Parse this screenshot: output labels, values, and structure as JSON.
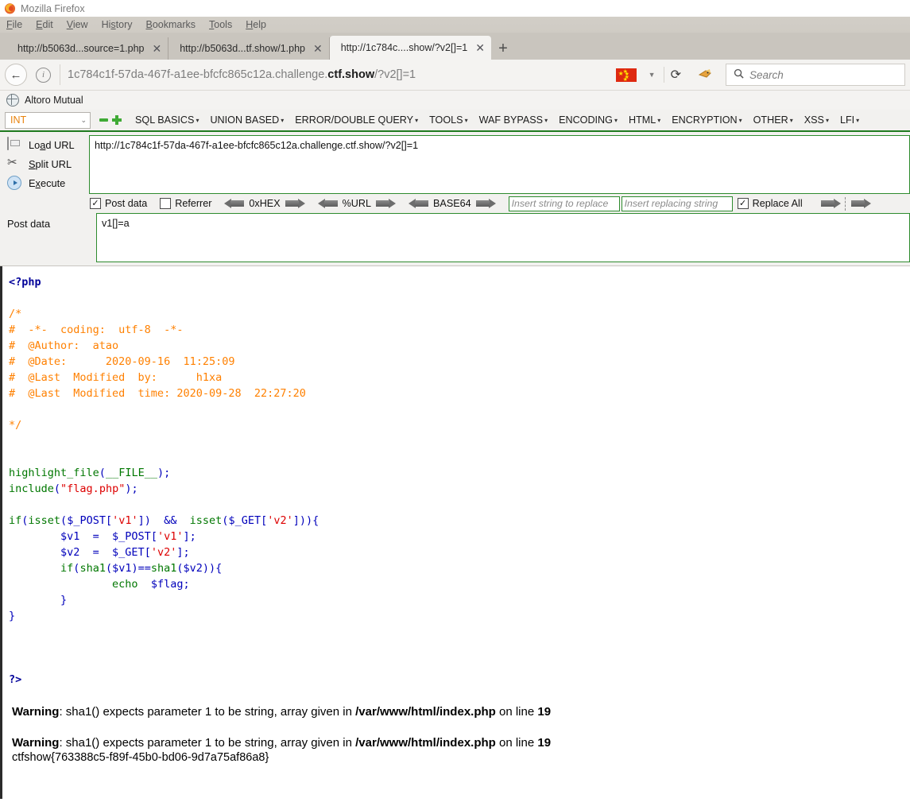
{
  "window": {
    "title": "Mozilla Firefox",
    "logo_icon": "firefox-logo"
  },
  "menubar": {
    "items": [
      "File",
      "Edit",
      "View",
      "History",
      "Bookmarks",
      "Tools",
      "Help"
    ]
  },
  "tabs": [
    {
      "label": "http://b5063d...source=1.php",
      "active": false,
      "close_icon": "close-icon"
    },
    {
      "label": "http://b5063d...tf.show/1.php",
      "active": false,
      "close_icon": "close-icon"
    },
    {
      "label": "http://1c784c....show/?v2[]=1",
      "active": true,
      "close_icon": "close-icon"
    }
  ],
  "newtab_label": "+",
  "navbar": {
    "back_icon": "back-arrow-icon",
    "info_icon": "page-info-icon",
    "url_prefix": "1c784c1f-57da-467f-a1ee-bfcfc865c12a.challenge.",
    "url_host_bold": "ctf.show",
    "url_suffix": "/?v2[]=1",
    "flag_icon": "china-flag-icon",
    "dropdown_icon": "chevron-down-icon",
    "reload_icon": "reload-icon",
    "pocket_icon": "pocket-icon",
    "search_icon": "search-icon",
    "search_placeholder": "Search",
    "search_value": ""
  },
  "bookmarks": [
    {
      "label": "Altoro Mutual",
      "icon": "globe-icon"
    }
  ],
  "hackbar": {
    "select_value": "INT",
    "remove_icon": "minus-icon",
    "add_icon": "plus-icon",
    "menu": [
      "SQL BASICS",
      "UNION BASED",
      "ERROR/DOUBLE QUERY",
      "TOOLS",
      "WAF BYPASS",
      "ENCODING",
      "HTML",
      "ENCRYPTION",
      "OTHER",
      "XSS",
      "LFI"
    ],
    "actions": [
      {
        "label_pre": "Lo",
        "label_accel": "a",
        "label_post": "d URL",
        "icon": "load-url-icon"
      },
      {
        "label_pre": "",
        "label_accel": "S",
        "label_post": "plit URL",
        "icon": "scissors-icon"
      },
      {
        "label_pre": "E",
        "label_accel": "x",
        "label_post": "ecute",
        "icon": "execute-icon"
      }
    ],
    "url_value": "http://1c784c1f-57da-467f-a1ee-bfcfc865c12a.challenge.ctf.show/?v2[]=1",
    "options": {
      "post_data_label": "Post data",
      "post_data_checked": "☑",
      "referrer_label": "Referrer",
      "referrer_checked": "",
      "hex_label": "0xHEX",
      "url_label": "%URL",
      "base64_label": "BASE64",
      "replace_search_placeholder": "Insert string to replace",
      "replace_with_placeholder": "Insert replacing string",
      "replace_all_label": "Replace All",
      "replace_all_checked": "☑"
    },
    "post_label": "Post data",
    "post_value": "v1[]=a"
  },
  "page": {
    "code_lines": [
      {
        "segs": [
          {
            "t": "<?php",
            "c": "c-tag"
          }
        ]
      },
      {
        "segs": [
          {
            "t": "",
            "c": ""
          }
        ]
      },
      {
        "segs": [
          {
            "t": "/*",
            "c": "c-cmt"
          }
        ]
      },
      {
        "segs": [
          {
            "t": "#  -*-  coding:  utf-8  -*-",
            "c": "c-cmt"
          }
        ]
      },
      {
        "segs": [
          {
            "t": "#  @Author:  atao",
            "c": "c-cmt"
          }
        ]
      },
      {
        "segs": [
          {
            "t": "#  @Date:      2020-09-16  11:25:09",
            "c": "c-cmt"
          }
        ]
      },
      {
        "segs": [
          {
            "t": "#  @Last  Modified  by:      h1xa",
            "c": "c-cmt"
          }
        ]
      },
      {
        "segs": [
          {
            "t": "#  @Last  Modified  time: 2020-09-28  22:27:20",
            "c": "c-cmt"
          }
        ]
      },
      {
        "segs": [
          {
            "t": "",
            "c": ""
          }
        ]
      },
      {
        "segs": [
          {
            "t": "*/",
            "c": "c-cmt"
          }
        ]
      },
      {
        "segs": [
          {
            "t": "",
            "c": ""
          }
        ]
      },
      {
        "segs": [
          {
            "t": "",
            "c": ""
          }
        ]
      },
      {
        "segs": [
          {
            "t": "highlight_file",
            "c": "c-kw"
          },
          {
            "t": "(",
            "c": "c-var"
          },
          {
            "t": "__FILE__",
            "c": "c-kw"
          },
          {
            "t": ");",
            "c": "c-var"
          }
        ]
      },
      {
        "segs": [
          {
            "t": "include",
            "c": "c-kw"
          },
          {
            "t": "(",
            "c": "c-var"
          },
          {
            "t": "\"flag.php\"",
            "c": "c-str"
          },
          {
            "t": ");",
            "c": "c-var"
          }
        ]
      },
      {
        "segs": [
          {
            "t": "",
            "c": ""
          }
        ]
      },
      {
        "segs": [
          {
            "t": "if",
            "c": "c-kw"
          },
          {
            "t": "(",
            "c": "c-var"
          },
          {
            "t": "isset",
            "c": "c-kw"
          },
          {
            "t": "(",
            "c": "c-var"
          },
          {
            "t": "$_POST",
            "c": "c-var"
          },
          {
            "t": "[",
            "c": "c-var"
          },
          {
            "t": "'v1'",
            "c": "c-str"
          },
          {
            "t": "])  &&  ",
            "c": "c-var"
          },
          {
            "t": "isset",
            "c": "c-kw"
          },
          {
            "t": "(",
            "c": "c-var"
          },
          {
            "t": "$_GET",
            "c": "c-var"
          },
          {
            "t": "[",
            "c": "c-var"
          },
          {
            "t": "'v2'",
            "c": "c-str"
          },
          {
            "t": "])){",
            "c": "c-var"
          }
        ]
      },
      {
        "segs": [
          {
            "t": "        $v1  =  $_POST",
            "c": "c-var"
          },
          {
            "t": "[",
            "c": "c-var"
          },
          {
            "t": "'v1'",
            "c": "c-str"
          },
          {
            "t": "];",
            "c": "c-var"
          }
        ]
      },
      {
        "segs": [
          {
            "t": "        $v2  =  $_GET",
            "c": "c-var"
          },
          {
            "t": "[",
            "c": "c-var"
          },
          {
            "t": "'v2'",
            "c": "c-str"
          },
          {
            "t": "];",
            "c": "c-var"
          }
        ]
      },
      {
        "segs": [
          {
            "t": "        ",
            "c": "c-var"
          },
          {
            "t": "if",
            "c": "c-kw"
          },
          {
            "t": "(",
            "c": "c-var"
          },
          {
            "t": "sha1",
            "c": "c-kw"
          },
          {
            "t": "(",
            "c": "c-var"
          },
          {
            "t": "$v1",
            "c": "c-var"
          },
          {
            "t": ")==",
            "c": "c-var"
          },
          {
            "t": "sha1",
            "c": "c-kw"
          },
          {
            "t": "(",
            "c": "c-var"
          },
          {
            "t": "$v2",
            "c": "c-var"
          },
          {
            "t": ")){",
            "c": "c-var"
          }
        ]
      },
      {
        "segs": [
          {
            "t": "                ",
            "c": "c-var"
          },
          {
            "t": "echo",
            "c": "c-kw"
          },
          {
            "t": "  ",
            "c": "c-var"
          },
          {
            "t": "$flag",
            "c": "c-var"
          },
          {
            "t": ";",
            "c": "c-var"
          }
        ]
      },
      {
        "segs": [
          {
            "t": "        }",
            "c": "c-var"
          }
        ]
      },
      {
        "segs": [
          {
            "t": "}",
            "c": "c-var"
          }
        ]
      },
      {
        "segs": [
          {
            "t": "",
            "c": ""
          }
        ]
      },
      {
        "segs": [
          {
            "t": "",
            "c": ""
          }
        ]
      },
      {
        "segs": [
          {
            "t": "",
            "c": ""
          }
        ]
      },
      {
        "segs": [
          {
            "t": "?>",
            "c": "c-tag"
          }
        ]
      }
    ],
    "warnings": [
      {
        "label": "Warning",
        "text": ": sha1() expects parameter 1 to be string, array given in ",
        "file": "/var/www/html/index.php",
        "on_line_text": " on line ",
        "line": "19"
      },
      {
        "label": "Warning",
        "text": ": sha1() expects parameter 1 to be string, array given in ",
        "file": "/var/www/html/index.php",
        "on_line_text": " on line ",
        "line": "19"
      }
    ],
    "flag": "ctfshow{763388c5-f89f-45b0-bd06-9d7a75af86a8}"
  }
}
